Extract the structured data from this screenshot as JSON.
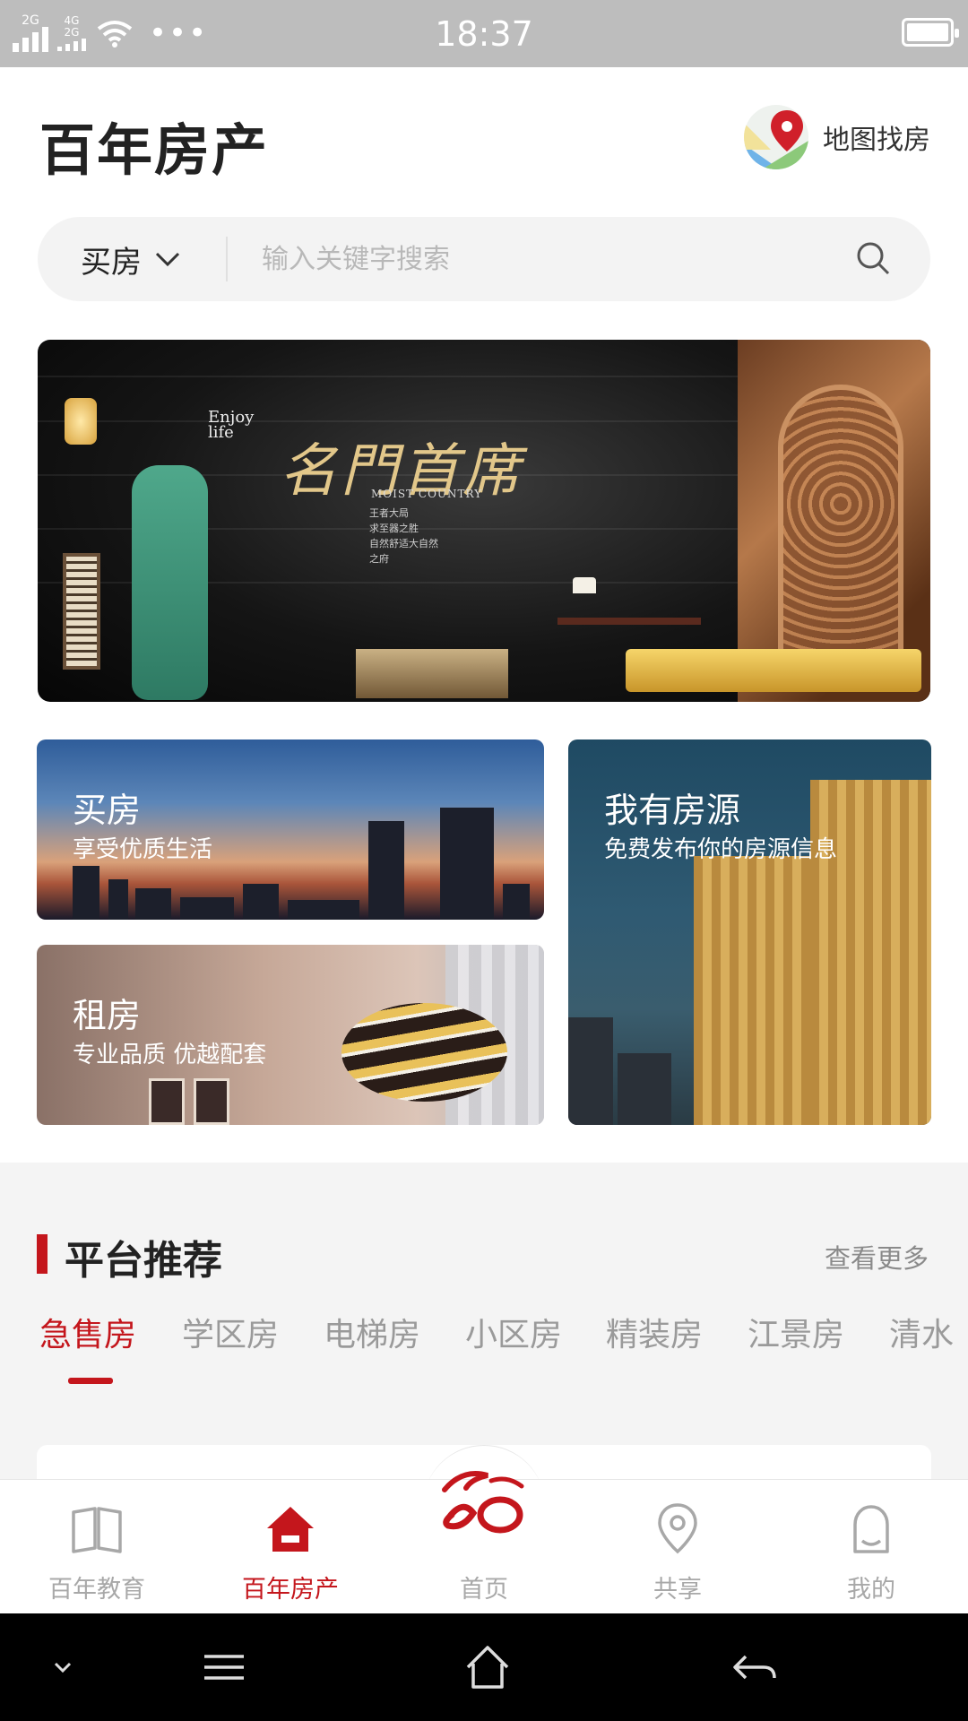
{
  "status_bar": {
    "sim1_label": "2G",
    "sim2_label": "4G\n2G",
    "more_dots": "•••",
    "time": "18:37"
  },
  "header": {
    "app_title": "百年房产",
    "map_link_label": "地图找房"
  },
  "search": {
    "type_label": "买房",
    "placeholder": "输入关键字搜索"
  },
  "banner": {
    "title": "名門首席",
    "subtitle": "MOIST COUNTRY",
    "enjoy_text": "Enjoy\nlife",
    "lines": "王者大局\n求至器之胜\n自然舒适大自然\n之府"
  },
  "tiles": {
    "buy": {
      "title": "买房",
      "subtitle": "享受优质生活"
    },
    "rent": {
      "title": "租房",
      "subtitle": "专业品质 优越配套"
    },
    "owner": {
      "title": "我有房源",
      "subtitle": "免费发布你的房源信息"
    }
  },
  "recommend": {
    "title": "平台推荐",
    "more_label": "查看更多",
    "tabs": [
      {
        "label": "急售房",
        "active": true
      },
      {
        "label": "学区房",
        "active": false
      },
      {
        "label": "电梯房",
        "active": false
      },
      {
        "label": "小区房",
        "active": false
      },
      {
        "label": "精装房",
        "active": false
      },
      {
        "label": "江景房",
        "active": false
      },
      {
        "label": "清水",
        "active": false
      }
    ]
  },
  "bottom_nav": {
    "items": [
      {
        "label": "百年教育",
        "icon": "book-icon",
        "active": false
      },
      {
        "label": "百年房产",
        "icon": "house-icon",
        "active": true
      },
      {
        "label": "首页",
        "icon": "brand-logo-icon",
        "active": false
      },
      {
        "label": "共享",
        "icon": "location-pin-icon",
        "active": false
      },
      {
        "label": "我的",
        "icon": "user-icon",
        "active": false
      }
    ]
  },
  "colors": {
    "accent": "#c4161c",
    "status_bar": "#bdbdbd",
    "muted_text": "#9a9a9a",
    "section_background": "#f4f4f4"
  }
}
